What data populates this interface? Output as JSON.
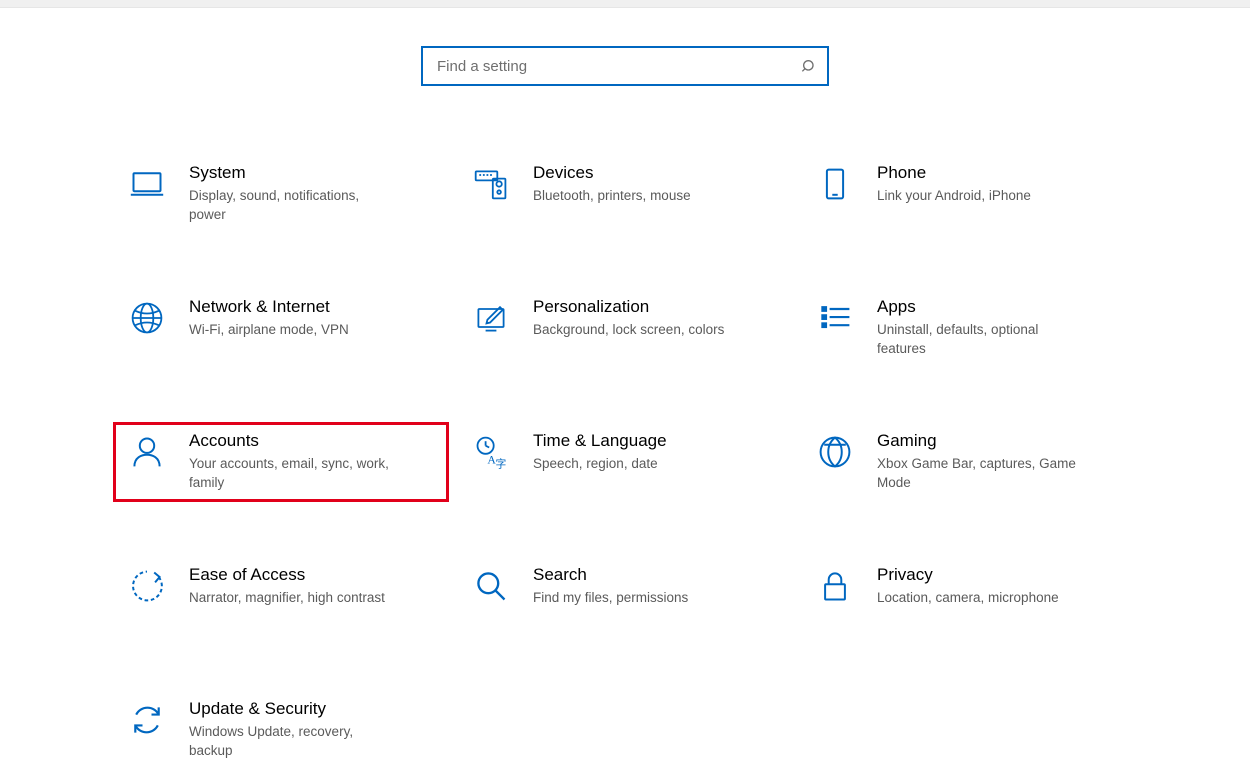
{
  "search": {
    "placeholder": "Find a setting"
  },
  "tiles": [
    {
      "title": "System",
      "desc": "Display, sound, notifications, power"
    },
    {
      "title": "Devices",
      "desc": "Bluetooth, printers, mouse"
    },
    {
      "title": "Phone",
      "desc": "Link your Android, iPhone"
    },
    {
      "title": "Network & Internet",
      "desc": "Wi-Fi, airplane mode, VPN"
    },
    {
      "title": "Personalization",
      "desc": "Background, lock screen, colors"
    },
    {
      "title": "Apps",
      "desc": "Uninstall, defaults, optional features"
    },
    {
      "title": "Accounts",
      "desc": "Your accounts, email, sync, work, family"
    },
    {
      "title": "Time & Language",
      "desc": "Speech, region, date"
    },
    {
      "title": "Gaming",
      "desc": "Xbox Game Bar, captures, Game Mode"
    },
    {
      "title": "Ease of Access",
      "desc": "Narrator, magnifier, high contrast"
    },
    {
      "title": "Search",
      "desc": "Find my files, permissions"
    },
    {
      "title": "Privacy",
      "desc": "Location, camera, microphone"
    },
    {
      "title": "Update & Security",
      "desc": "Windows Update, recovery, backup"
    }
  ]
}
